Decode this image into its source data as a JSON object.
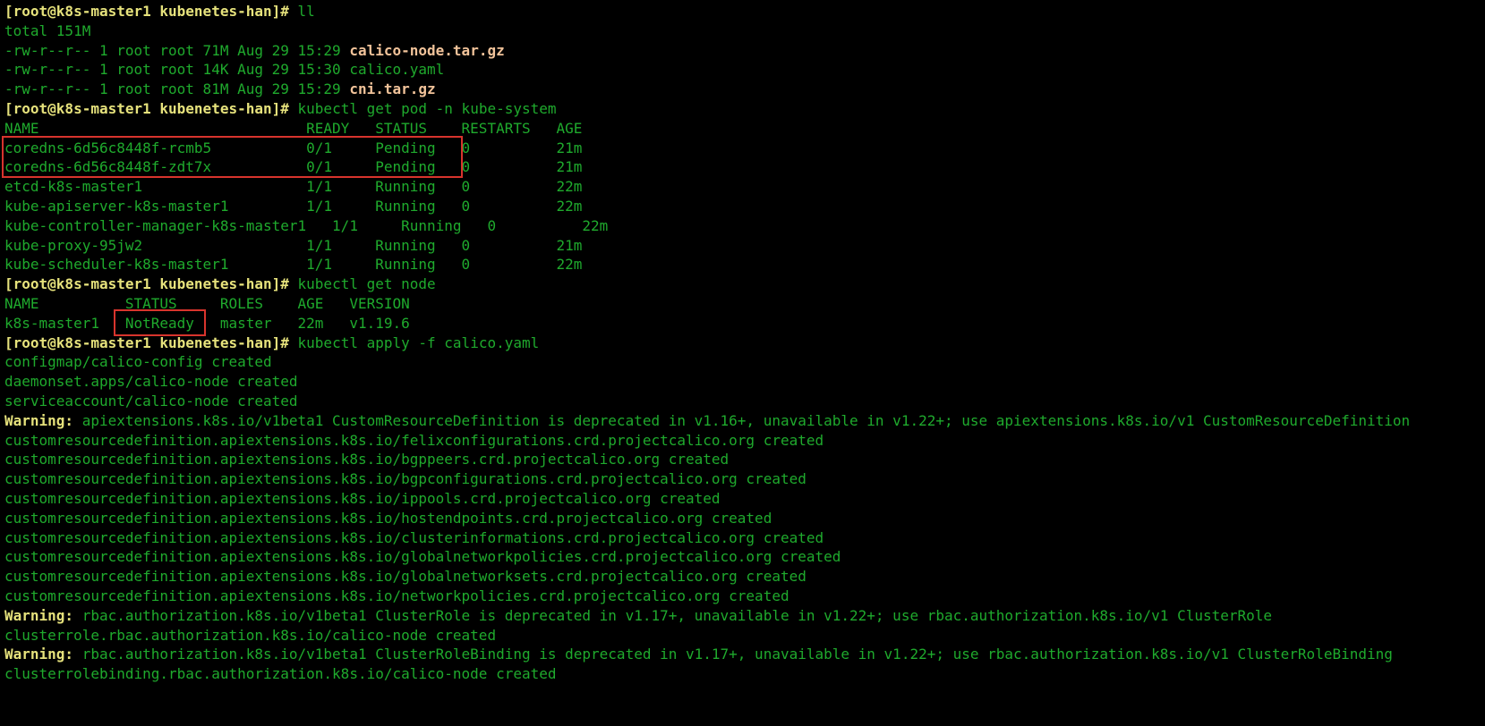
{
  "prompt": "[root@k8s-master1 kubenetes-han]#",
  "colors": {
    "background": "#000000",
    "text_green": "#1faa2d",
    "prompt_yellow": "#e6e27c",
    "archive_file": "#f1c39a",
    "highlight_red": "#d8342d"
  },
  "cmd1": {
    "command": "ll",
    "total": "total 151M",
    "files": [
      {
        "meta": "-rw-r--r-- 1 root root 71M Aug 29 15:29",
        "name": "calico-node.tar.gz"
      },
      {
        "meta": "-rw-r--r-- 1 root root 14K Aug 29 15:30",
        "name": "calico.yaml"
      },
      {
        "meta": "-rw-r--r-- 1 root root 81M Aug 29 15:29",
        "name": "cni.tar.gz"
      }
    ]
  },
  "cmd2": {
    "command": "kubectl get pod -n kube-system",
    "header": "NAME                               READY   STATUS    RESTARTS   AGE",
    "rows": [
      "coredns-6d56c8448f-rcmb5           0/1     Pending   0          21m",
      "coredns-6d56c8448f-zdt7x           0/1     Pending   0          21m",
      "etcd-k8s-master1                   1/1     Running   0          22m",
      "kube-apiserver-k8s-master1         1/1     Running   0          22m",
      "kube-controller-manager-k8s-master1   1/1     Running   0          22m",
      "kube-proxy-95jw2                   1/1     Running   0          21m",
      "kube-scheduler-k8s-master1         1/1     Running   0          22m"
    ]
  },
  "cmd3": {
    "command": "kubectl get node",
    "header": "NAME          STATUS     ROLES    AGE   VERSION",
    "rows": [
      "k8s-master1   NotReady   master   22m   v1.19.6"
    ]
  },
  "cmd4": {
    "command": "kubectl apply -f calico.yaml",
    "lines": [
      {
        "text": "configmap/calico-config created"
      },
      {
        "text": "daemonset.apps/calico-node created"
      },
      {
        "text": "serviceaccount/calico-node created"
      },
      {
        "warn": "Warning:",
        "text": " apiextensions.k8s.io/v1beta1 CustomResourceDefinition is deprecated in v1.16+, unavailable in v1.22+; use apiextensions.k8s.io/v1 CustomResourceDefinition"
      },
      {
        "text": "customresourcedefinition.apiextensions.k8s.io/felixconfigurations.crd.projectcalico.org created"
      },
      {
        "text": "customresourcedefinition.apiextensions.k8s.io/bgppeers.crd.projectcalico.org created"
      },
      {
        "text": "customresourcedefinition.apiextensions.k8s.io/bgpconfigurations.crd.projectcalico.org created"
      },
      {
        "text": "customresourcedefinition.apiextensions.k8s.io/ippools.crd.projectcalico.org created"
      },
      {
        "text": "customresourcedefinition.apiextensions.k8s.io/hostendpoints.crd.projectcalico.org created"
      },
      {
        "text": "customresourcedefinition.apiextensions.k8s.io/clusterinformations.crd.projectcalico.org created"
      },
      {
        "text": "customresourcedefinition.apiextensions.k8s.io/globalnetworkpolicies.crd.projectcalico.org created"
      },
      {
        "text": "customresourcedefinition.apiextensions.k8s.io/globalnetworksets.crd.projectcalico.org created"
      },
      {
        "text": "customresourcedefinition.apiextensions.k8s.io/networkpolicies.crd.projectcalico.org created"
      },
      {
        "warn": "Warning:",
        "text": " rbac.authorization.k8s.io/v1beta1 ClusterRole is deprecated in v1.17+, unavailable in v1.22+; use rbac.authorization.k8s.io/v1 ClusterRole"
      },
      {
        "text": "clusterrole.rbac.authorization.k8s.io/calico-node created"
      },
      {
        "warn": "Warning:",
        "text": " rbac.authorization.k8s.io/v1beta1 ClusterRoleBinding is deprecated in v1.17+, unavailable in v1.22+; use rbac.authorization.k8s.io/v1 ClusterRoleBinding"
      },
      {
        "text": "clusterrolebinding.rbac.authorization.k8s.io/calico-node created"
      }
    ]
  }
}
